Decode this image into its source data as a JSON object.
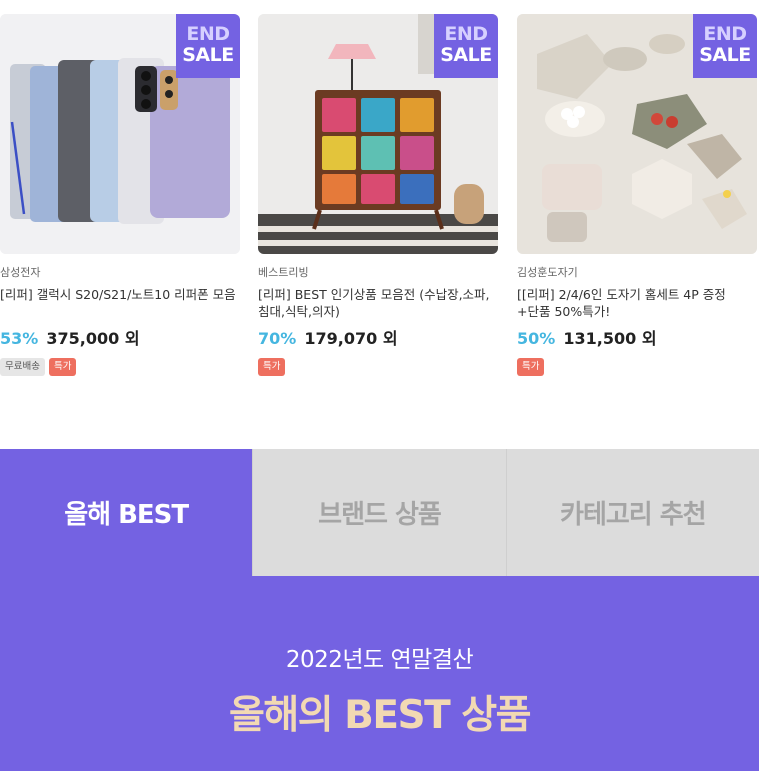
{
  "products": [
    {
      "badge": {
        "line1": "END",
        "line2": "SALE"
      },
      "image_icon": "phones-image",
      "brand": "삼성전자",
      "title": "[리퍼] 갤럭시 S20/S21/노트10 리퍼폰 모음",
      "discount": "53%",
      "price": "375,000 외",
      "tags": [
        "무료배송",
        "특가"
      ]
    },
    {
      "badge": {
        "line1": "END",
        "line2": "SALE"
      },
      "image_icon": "cabinet-image",
      "brand": "베스트리빙",
      "title": "[리퍼] BEST 인기상품 모음전 (수납장,소파,침대,식탁,의자)",
      "discount": "70%",
      "price": "179,070 외",
      "tags": [
        "특가"
      ]
    },
    {
      "badge": {
        "line1": "END",
        "line2": "SALE"
      },
      "image_icon": "tableware-image",
      "brand": "김성훈도자기",
      "title": "[[리퍼] 2/4/6인 도자기 홈세트 4P 증정+단품 50%특가!",
      "discount": "50%",
      "price": "131,500 외",
      "tags": [
        "특가"
      ]
    }
  ],
  "tabs": [
    {
      "label": "올해 BEST",
      "active": true
    },
    {
      "label": "브랜드 상품",
      "active": false
    },
    {
      "label": "카테고리 추천",
      "active": false
    }
  ],
  "banner": {
    "subtitle": "2022년도 연말결산",
    "title": "올해의 BEST 상품"
  },
  "colors": {
    "accent": "#7462e2",
    "discount": "#45b6e0",
    "special_tag": "#ee6f5f",
    "banner_title": "#f2d9b3"
  }
}
